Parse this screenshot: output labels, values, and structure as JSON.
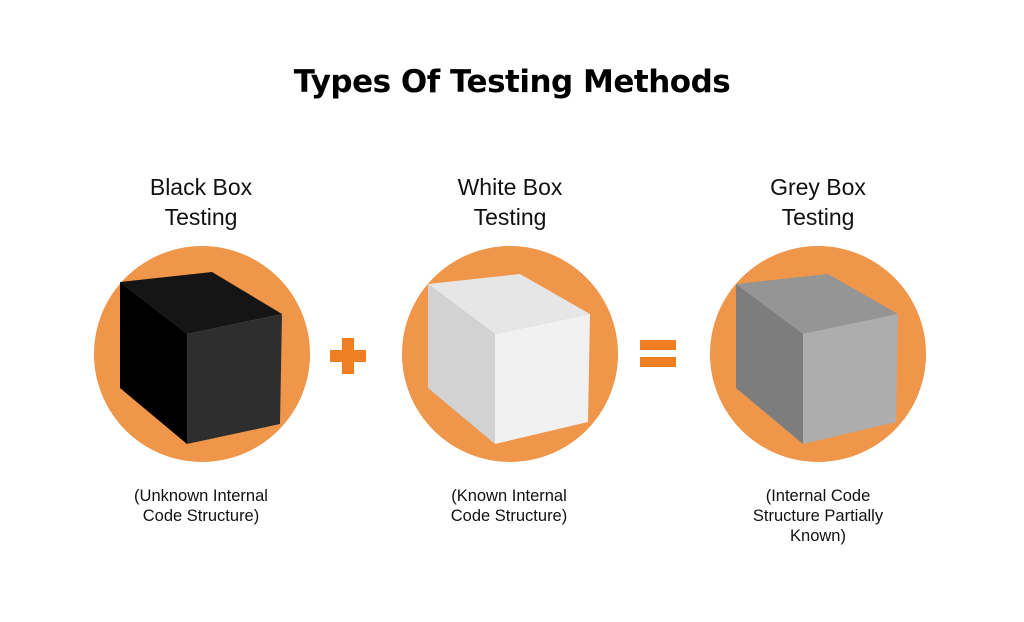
{
  "title": "Types Of Testing Methods",
  "colors": {
    "accent": "#F0964B",
    "operator": "#F07E22"
  },
  "methods": [
    {
      "label_line1": "Black Box",
      "label_line2": "Testing",
      "desc_line1": "(Unknown Internal",
      "desc_line2": "Code Structure)",
      "desc_line3": "",
      "cube": {
        "top": "#151515",
        "left": "#000000",
        "front": "#2e2e2e"
      }
    },
    {
      "label_line1": "White Box",
      "label_line2": "Testing",
      "desc_line1": "(Known Internal",
      "desc_line2": "Code Structure)",
      "desc_line3": "",
      "cube": {
        "top": "#e6e6e6",
        "left": "#d2d2d2",
        "front": "#f1f1f1"
      }
    },
    {
      "label_line1": "Grey Box",
      "label_line2": "Testing",
      "desc_line1": "(Internal Code",
      "desc_line2": "Structure Partially",
      "desc_line3": "Known)",
      "cube": {
        "top": "#959595",
        "left": "#7d7d7d",
        "front": "#adadad"
      }
    }
  ],
  "operators": {
    "plus": "plus-icon",
    "equals": "equals-icon"
  }
}
